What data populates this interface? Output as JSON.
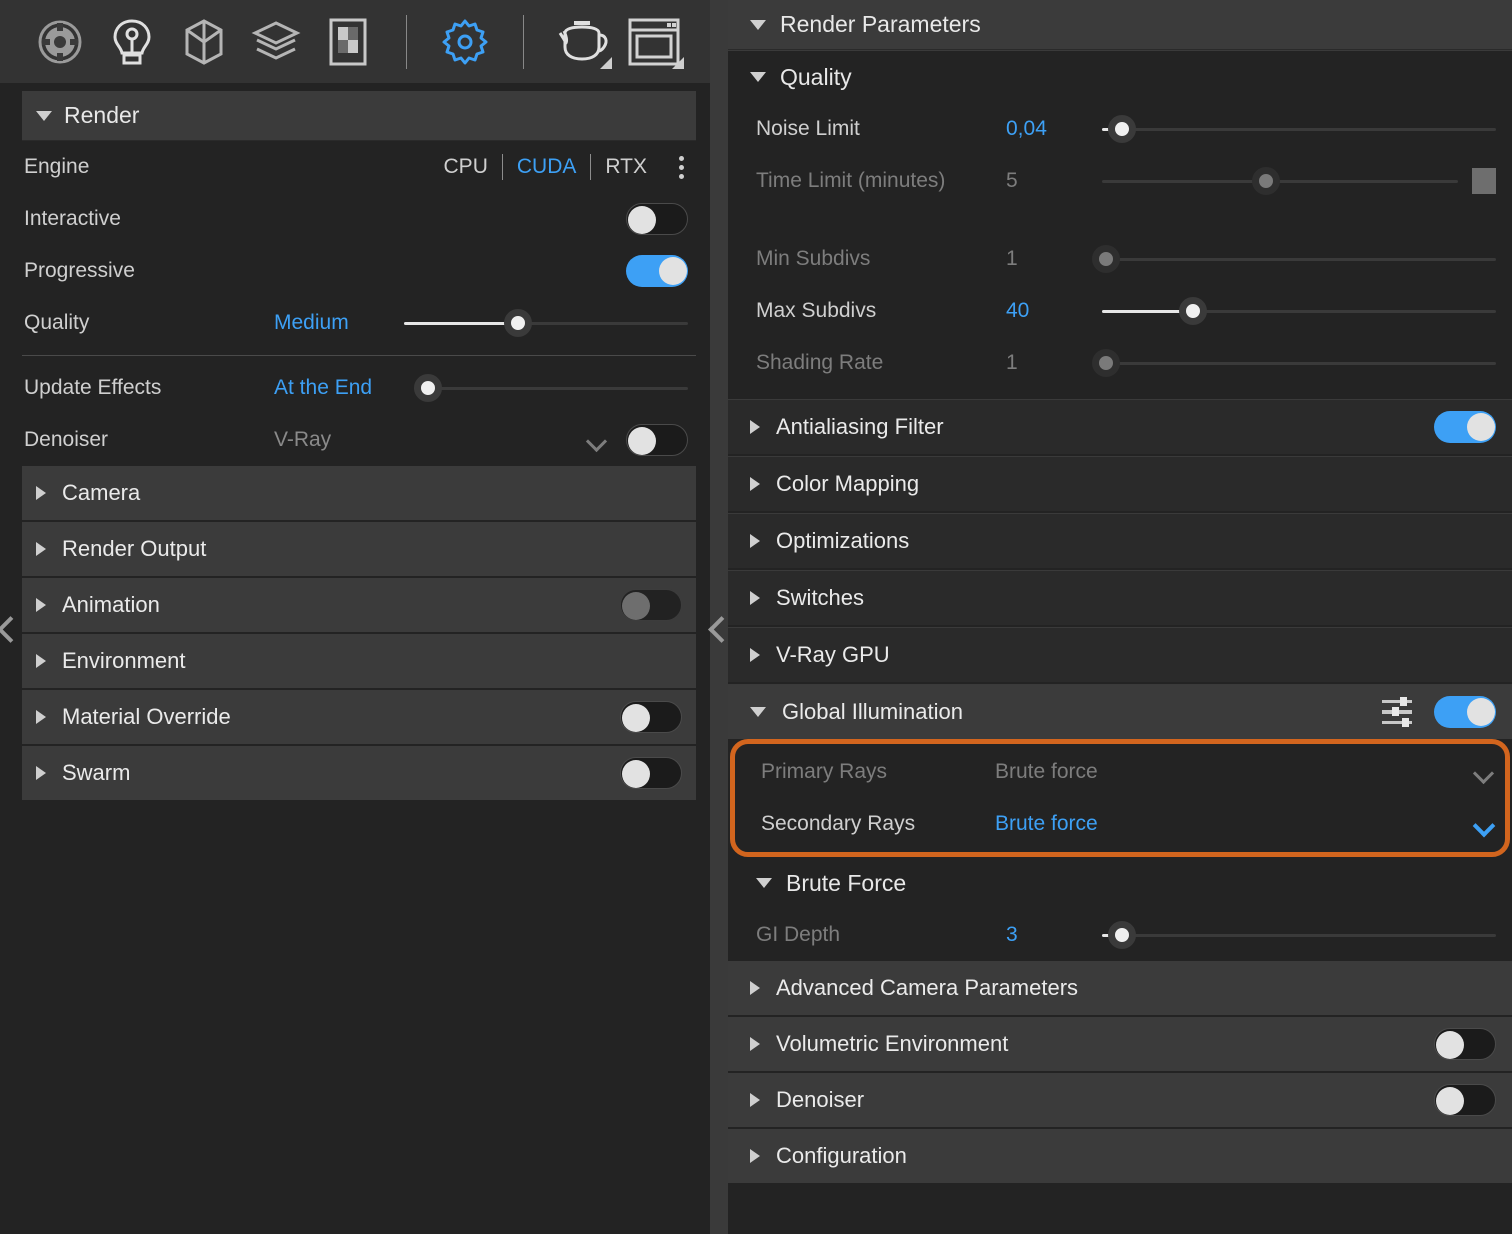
{
  "colors": {
    "accent_blue": "#3da0f5",
    "highlight_orange": "#d2651e",
    "panel_bg": "#232323",
    "row_bg": "#3b3b3b",
    "toolbar_bg": "#333333"
  },
  "toolbar": {
    "items": [
      {
        "name": "material-sphere-icon",
        "label": "Materials"
      },
      {
        "name": "light-bulb-icon",
        "label": "Lights"
      },
      {
        "name": "geometry-cube-icon",
        "label": "Geometry"
      },
      {
        "name": "layers-icon",
        "label": "Render Elements"
      },
      {
        "name": "texture-swatch-icon",
        "label": "Textures"
      },
      {
        "name": "gear-icon",
        "label": "Render Settings"
      },
      {
        "name": "teapot-icon",
        "label": "Material Preview"
      },
      {
        "name": "frame-buffer-icon",
        "label": "Frame Buffer"
      }
    ]
  },
  "left_panel": {
    "header": {
      "title": "Render",
      "expanded": true
    },
    "engine": {
      "label": "Engine",
      "options": [
        "CPU",
        "CUDA",
        "RTX"
      ],
      "selected": "CUDA",
      "menu_icon": "kebab-menu-icon"
    },
    "interactive": {
      "label": "Interactive",
      "value": "off"
    },
    "progressive": {
      "label": "Progressive",
      "value": "on"
    },
    "quality": {
      "label": "Quality",
      "value": "Medium",
      "slider_percent": 40
    },
    "update_effects": {
      "label": "Update Effects",
      "value": "At the End",
      "slider_percent": 2
    },
    "denoiser": {
      "label": "Denoiser",
      "value": "V-Ray",
      "toggle": "off"
    },
    "sections": [
      {
        "label": "Camera",
        "expanded": false,
        "toggle": null
      },
      {
        "label": "Render Output",
        "expanded": false,
        "toggle": null
      },
      {
        "label": "Animation",
        "expanded": false,
        "toggle": "off-disabled"
      },
      {
        "label": "Environment",
        "expanded": false,
        "toggle": null
      },
      {
        "label": "Material Override",
        "expanded": false,
        "toggle": "off"
      },
      {
        "label": "Swarm",
        "expanded": false,
        "toggle": "off"
      }
    ]
  },
  "right_panel": {
    "header": {
      "title": "Render Parameters",
      "expanded": true
    },
    "quality_group": {
      "title": "Quality",
      "expanded": true,
      "rows": [
        {
          "label": "Noise Limit",
          "value": "0,04",
          "enabled": true,
          "slider_percent": 5,
          "extra": null
        },
        {
          "label": "Time Limit (minutes)",
          "value": "5",
          "enabled": false,
          "slider_percent": 46,
          "extra": "stop-square-button"
        },
        {
          "label": "Min Subdivs",
          "value": "1",
          "enabled": false,
          "slider_percent": 1,
          "extra": null
        },
        {
          "label": "Max Subdivs",
          "value": "40",
          "enabled": true,
          "slider_percent": 23,
          "extra": null
        },
        {
          "label": "Shading Rate",
          "value": "1",
          "enabled": false,
          "slider_percent": 1,
          "extra": null
        }
      ]
    },
    "sections": [
      {
        "label": "Antialiasing Filter",
        "expanded": false,
        "toggle": "on"
      },
      {
        "label": "Color Mapping",
        "expanded": false,
        "toggle": null
      },
      {
        "label": "Optimizations",
        "expanded": false,
        "toggle": null
      },
      {
        "label": "Switches",
        "expanded": false,
        "toggle": null
      },
      {
        "label": "V-Ray GPU",
        "expanded": false,
        "toggle": null
      }
    ],
    "global_illumination": {
      "label": "Global Illumination",
      "expanded": true,
      "settings_icon": "sliders-icon",
      "toggle": "on",
      "highlighted": true,
      "primary_rays": {
        "label": "Primary Rays",
        "value": "Brute force",
        "enabled": false
      },
      "secondary_rays": {
        "label": "Secondary Rays",
        "value": "Brute force",
        "enabled": true
      }
    },
    "brute_force": {
      "title": "Brute Force",
      "expanded": true,
      "gi_depth": {
        "label": "GI Depth",
        "value": "3",
        "slider_percent": 5
      }
    },
    "bottom_sections": [
      {
        "label": "Advanced Camera Parameters",
        "expanded": false,
        "toggle": null
      },
      {
        "label": "Volumetric Environment",
        "expanded": false,
        "toggle": "off"
      },
      {
        "label": "Denoiser",
        "expanded": false,
        "toggle": "off"
      },
      {
        "label": "Configuration",
        "expanded": false,
        "toggle": null
      }
    ]
  }
}
